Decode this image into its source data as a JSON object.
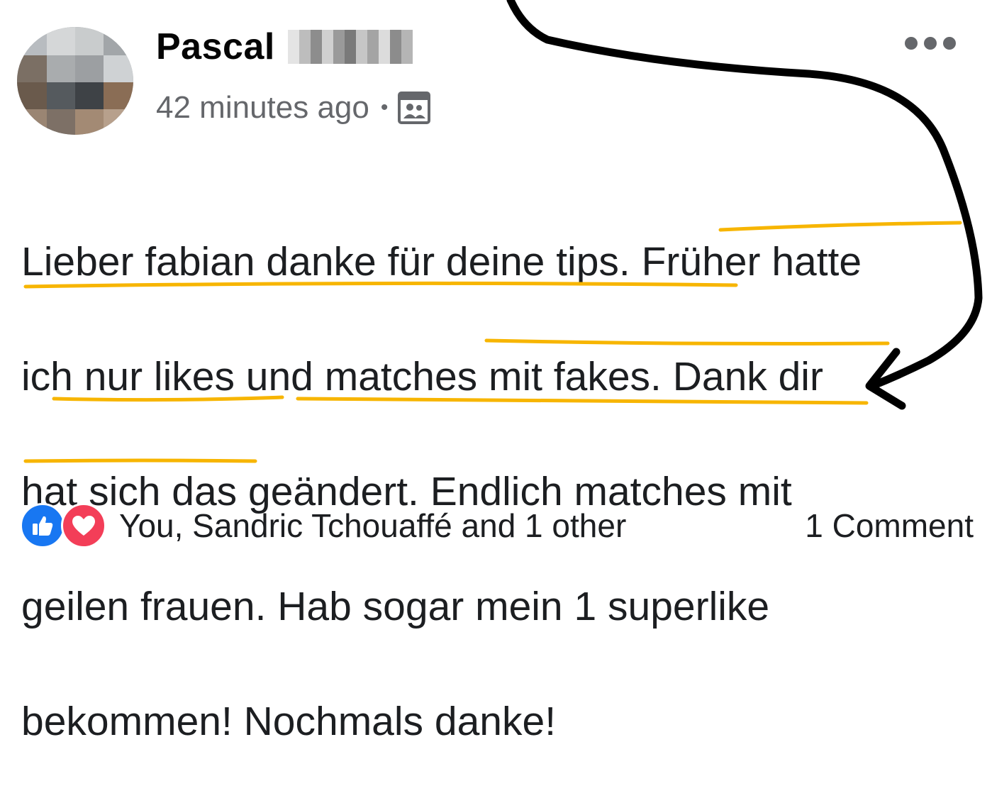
{
  "post": {
    "author_name": "Pascal",
    "timestamp": "42 minutes ago",
    "separator": "•",
    "audience_icon": "group-audience-icon",
    "more_icon": "more-options-icon",
    "body_lines": [
      "Lieber fabian danke für deine tips. Früher hatte",
      "ich nur likes und matches mit fakes. Dank dir",
      "hat sich das geändert. Endlich matches mit",
      "geilen frauen. Hab sogar mein 1 superlike",
      "bekommen! Nochmals danke!"
    ]
  },
  "reactions": {
    "icons": [
      "like-icon",
      "love-icon"
    ],
    "summary": "You, Sandric Tchouaffé and 1 other",
    "comments": "1 Comment"
  },
  "annotations": {
    "underline_color": "#f7b500",
    "arrow_color": "#000000"
  },
  "colors": {
    "text": "#1c1e21",
    "secondary": "#65676b",
    "like_blue": "#1877f2",
    "love_red": "#f33e58"
  }
}
